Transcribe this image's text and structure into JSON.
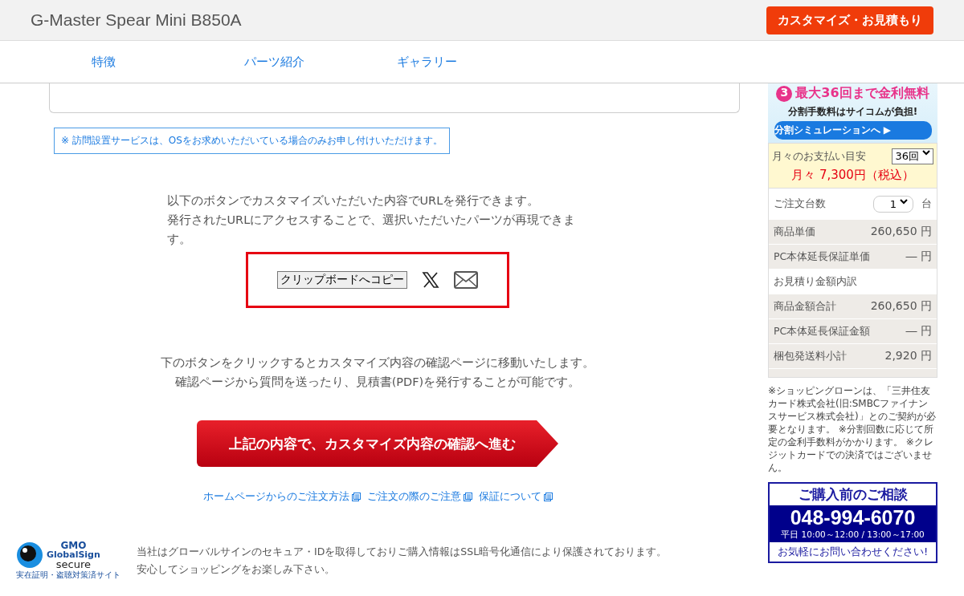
{
  "header": {
    "title": "G-Master Spear Mini B850A",
    "cta": "カスタマイズ・お見積もり"
  },
  "tabs": [
    {
      "label": "特徴",
      "selected": false
    },
    {
      "label": "パーツ紹介",
      "selected": false
    },
    {
      "label": "ギャラリー",
      "selected": false
    }
  ],
  "notice": "※ 訪問設置サービスは、OSをお求めいただいている場合のみお申し付けいただけます。",
  "share": {
    "text_lines": [
      "以下のボタンでカスタマイズいただいた内容でURLを発行できます。",
      "発行されたURLにアクセスすることで、選択いただいたパーツが再現できます。"
    ],
    "copy_button": "クリップボードへコピー"
  },
  "confirm": {
    "text_lines": [
      "下のボタンをクリックするとカスタマイズ内容の確認ページに移動いたします。",
      "確認ページから質問を送ったり、見積書(PDF)を発行することが可能です。"
    ],
    "button": "上記の内容で、カスタマイズ内容の確認へ進む"
  },
  "links": [
    "ホームページからのご注文方法",
    "ご注文の際のご注意",
    "保証について"
  ],
  "security": {
    "logo_lines": [
      "GMO",
      "GlobalSign",
      "secure",
      "実在証明・盗聴対策済サイト"
    ],
    "text_lines": [
      "当社はグローバルサインのセキュア・IDを取得しておりご購入情報はSSL暗号化通信により保護されております。",
      "安心してショッピングをお楽しみ下さい。"
    ]
  },
  "sidebar": {
    "banner": {
      "badge": "3",
      "headline": "最大36回まで金利無料",
      "sub": "分割手数料はサイコムが負担!",
      "button": "分割シミュレーションへ ▶"
    },
    "monthly": {
      "label": "月々のお支払い目安",
      "installments": "36回",
      "amount": "月々 7,300円（税込）"
    },
    "quantity": {
      "label": "ご注文台数",
      "value": "1",
      "unit": "台"
    },
    "rows": [
      {
        "kind": "price",
        "label": "商品単価",
        "value": "260,650 円"
      },
      {
        "kind": "price",
        "label": "PC本体延長保証単価",
        "value": "― 円"
      },
      {
        "kind": "heading",
        "label": "お見積り金額内訳"
      },
      {
        "kind": "price",
        "label": "商品金額合計",
        "value": "260,650 円"
      },
      {
        "kind": "price",
        "label": "PC本体延長保証金額",
        "value": "― 円"
      },
      {
        "kind": "price",
        "label": "梱包発送料小計",
        "value": "2,920 円"
      }
    ],
    "note": "※ショッピングローンは、「三井住友カード株式会社(旧:SMBCファイナンスサービス株式会社)」とのご契約が必要となります。 ※分割回数に応じて所定の金利手数料がかかります。 ※クレジットカードでの決済ではございません。",
    "contact": {
      "title": "ご購入前のご相談",
      "phone": "048-994-6070",
      "hours": "平日 10:00～12:00 / 13:00～17:00",
      "footer": "お気軽にお問い合わせください!"
    }
  }
}
